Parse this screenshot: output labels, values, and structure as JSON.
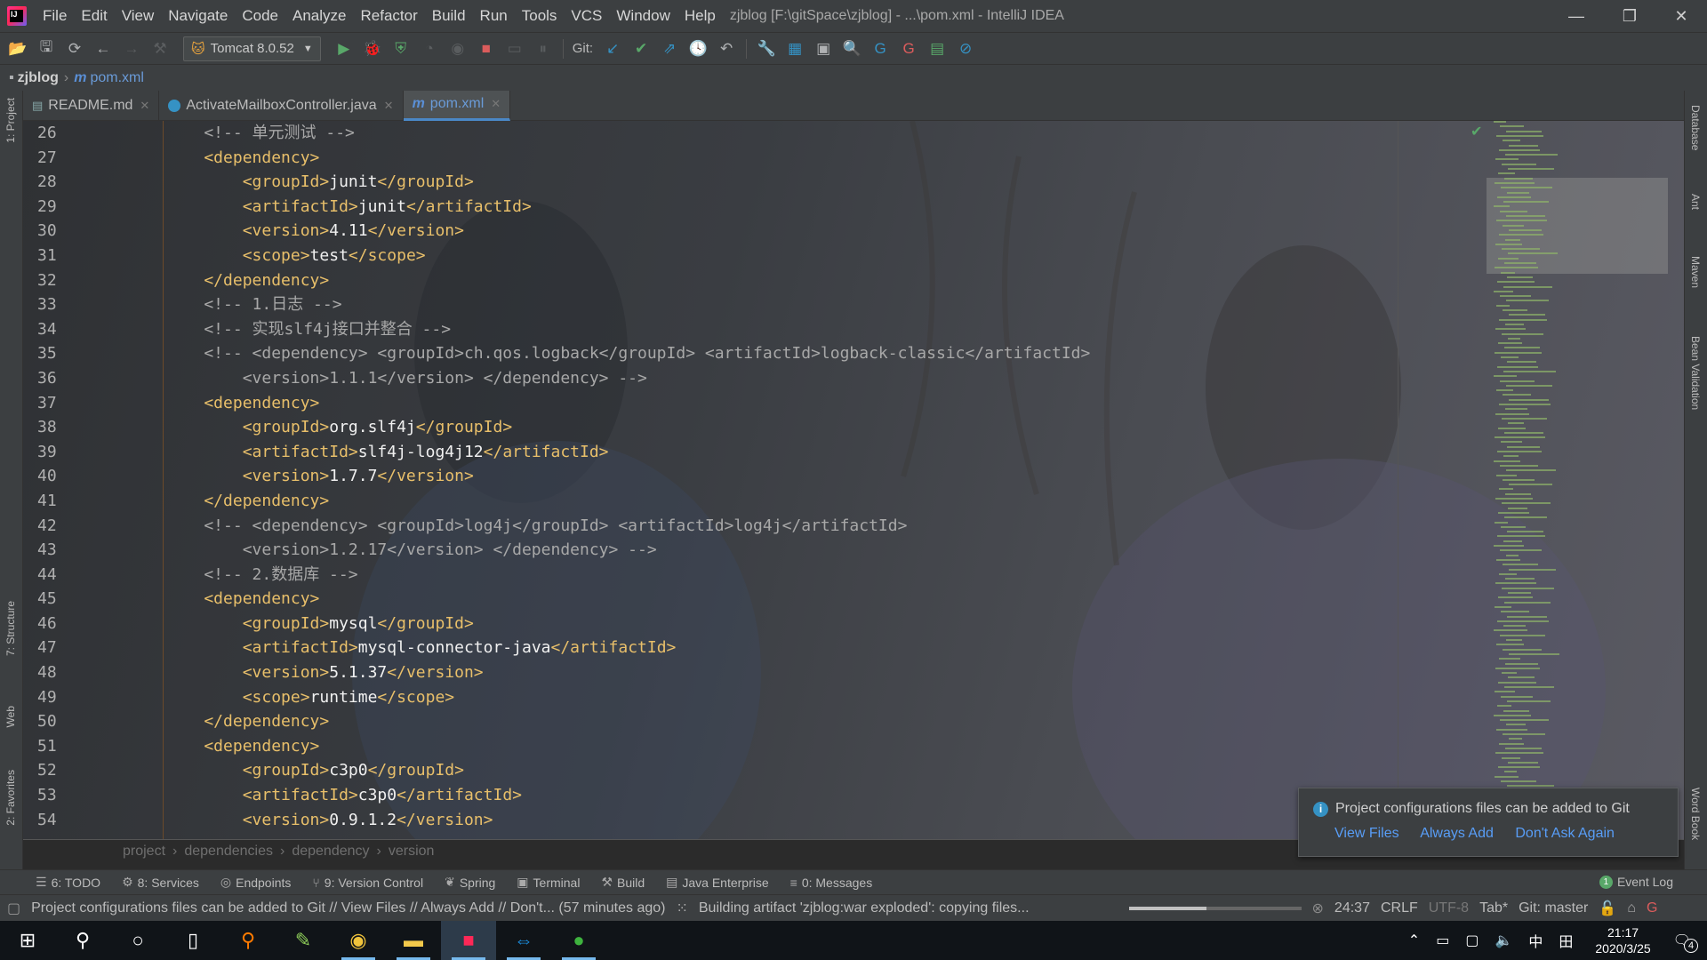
{
  "titlebar": {
    "menus": [
      "File",
      "Edit",
      "View",
      "Navigate",
      "Code",
      "Analyze",
      "Refactor",
      "Build",
      "Run",
      "Tools",
      "VCS",
      "Window",
      "Help"
    ],
    "window_title": "zjblog [F:\\gitSpace\\zjblog] - ...\\pom.xml - IntelliJ IDEA",
    "minimize": "—",
    "restore": "❐",
    "close": "✕"
  },
  "toolbar": {
    "run_config": "Tomcat 8.0.52",
    "git_label": "Git:"
  },
  "navbar": {
    "project": "zjblog",
    "file": "pom.xml"
  },
  "tabs": [
    {
      "label": "README.md",
      "icon": "markdown-icon"
    },
    {
      "label": "ActivateMailboxController.java",
      "icon": "java-class-icon"
    },
    {
      "label": "pom.xml",
      "icon": "maven-icon"
    }
  ],
  "left_stripe": [
    "1: Project",
    "7: Structure",
    "Web",
    "2: Favorites"
  ],
  "right_stripe": [
    "Database",
    "Ant",
    "Maven",
    "Bean Validation",
    "Word Book"
  ],
  "editor": {
    "line_numbers": [
      "26",
      "27",
      "28",
      "29",
      "30",
      "31",
      "32",
      "33",
      "34",
      "35",
      "36",
      "37",
      "38",
      "39",
      "40",
      "41",
      "42",
      "43",
      "44",
      "45",
      "46",
      "47",
      "48",
      "49",
      "50",
      "51",
      "52",
      "53",
      "54"
    ],
    "lines": [
      [
        {
          "t": "cm",
          "v": "    <!-- 单元测试 -->"
        }
      ],
      [
        {
          "t": "tag",
          "v": "    <dependency>"
        }
      ],
      [
        {
          "t": "tag",
          "v": "        <groupId>"
        },
        {
          "t": "tx",
          "v": "junit"
        },
        {
          "t": "tag",
          "v": "</groupId>"
        }
      ],
      [
        {
          "t": "tag",
          "v": "        <artifactId>"
        },
        {
          "t": "tx",
          "v": "junit"
        },
        {
          "t": "tag",
          "v": "</artifactId>"
        }
      ],
      [
        {
          "t": "tag",
          "v": "        <version>"
        },
        {
          "t": "tx",
          "v": "4.11"
        },
        {
          "t": "tag",
          "v": "</version>"
        }
      ],
      [
        {
          "t": "tag",
          "v": "        <scope>"
        },
        {
          "t": "tx",
          "v": "test"
        },
        {
          "t": "tag",
          "v": "</scope>"
        }
      ],
      [
        {
          "t": "tag",
          "v": "    </dependency>"
        }
      ],
      [
        {
          "t": "cm",
          "v": "    <!-- 1.日志 -->"
        }
      ],
      [
        {
          "t": "cm",
          "v": "    <!-- 实现slf4j接口并整合 -->"
        }
      ],
      [
        {
          "t": "cm",
          "v": "    <!-- <dependency> <groupId>ch.qos.logback</groupId> <artifactId>logback-classic</artifactId>"
        }
      ],
      [
        {
          "t": "cm",
          "v": "        <version>1.1.1</version> </dependency> -->"
        }
      ],
      [
        {
          "t": "tag",
          "v": "    <dependency>"
        }
      ],
      [
        {
          "t": "tag",
          "v": "        <groupId>"
        },
        {
          "t": "tx",
          "v": "org.slf4j"
        },
        {
          "t": "tag",
          "v": "</groupId>"
        }
      ],
      [
        {
          "t": "tag",
          "v": "        <artifactId>"
        },
        {
          "t": "tx",
          "v": "slf4j-log4j12"
        },
        {
          "t": "tag",
          "v": "</artifactId>"
        }
      ],
      [
        {
          "t": "tag",
          "v": "        <version>"
        },
        {
          "t": "tx",
          "v": "1.7.7"
        },
        {
          "t": "tag",
          "v": "</version>"
        }
      ],
      [
        {
          "t": "tag",
          "v": "    </dependency>"
        }
      ],
      [
        {
          "t": "cm",
          "v": "    <!-- <dependency> <groupId>log4j</groupId> <artifactId>log4j</artifactId>"
        }
      ],
      [
        {
          "t": "cm",
          "v": "        <version>1.2.17</version> </dependency> -->"
        }
      ],
      [
        {
          "t": "cm",
          "v": "    <!-- 2.数据库 -->"
        }
      ],
      [
        {
          "t": "tag",
          "v": "    <dependency>"
        }
      ],
      [
        {
          "t": "tag",
          "v": "        <groupId>"
        },
        {
          "t": "tx",
          "v": "mysql"
        },
        {
          "t": "tag",
          "v": "</groupId>"
        }
      ],
      [
        {
          "t": "tag",
          "v": "        <artifactId>"
        },
        {
          "t": "tx",
          "v": "mysql-connector-java"
        },
        {
          "t": "tag",
          "v": "</artifactId>"
        }
      ],
      [
        {
          "t": "tag",
          "v": "        <version>"
        },
        {
          "t": "tx",
          "v": "5.1.37"
        },
        {
          "t": "tag",
          "v": "</version>"
        }
      ],
      [
        {
          "t": "tag",
          "v": "        <scope>"
        },
        {
          "t": "tx",
          "v": "runtime"
        },
        {
          "t": "tag",
          "v": "</scope>"
        }
      ],
      [
        {
          "t": "tag",
          "v": "    </dependency>"
        }
      ],
      [
        {
          "t": "tag",
          "v": "    <dependency>"
        }
      ],
      [
        {
          "t": "tag",
          "v": "        <groupId>"
        },
        {
          "t": "tx",
          "v": "c3p0"
        },
        {
          "t": "tag",
          "v": "</groupId>"
        }
      ],
      [
        {
          "t": "tag",
          "v": "        <artifactId>"
        },
        {
          "t": "tx",
          "v": "c3p0"
        },
        {
          "t": "tag",
          "v": "</artifactId>"
        }
      ],
      [
        {
          "t": "tag",
          "v": "        <version>"
        },
        {
          "t": "tx",
          "v": "0.9.1.2"
        },
        {
          "t": "tag",
          "v": "</version>"
        }
      ]
    ],
    "breadcrumb": [
      "project",
      "dependencies",
      "dependency",
      "version"
    ]
  },
  "notification": {
    "message": "Project configurations files can be added to Git",
    "links": [
      "View Files",
      "Always Add",
      "Don't Ask Again"
    ]
  },
  "tool_windows": [
    {
      "label": "6: TODO",
      "icon": "todo-icon"
    },
    {
      "label": "8: Services",
      "icon": "services-icon"
    },
    {
      "label": "Endpoints",
      "icon": "endpoints-icon"
    },
    {
      "label": "9: Version Control",
      "icon": "vcs-icon"
    },
    {
      "label": "Spring",
      "icon": "spring-icon"
    },
    {
      "label": "Terminal",
      "icon": "terminal-icon"
    },
    {
      "label": "Build",
      "icon": "build-icon"
    },
    {
      "label": "Java Enterprise",
      "icon": "java-enterprise-icon"
    },
    {
      "label": "0: Messages",
      "icon": "messages-icon"
    }
  ],
  "event_log": {
    "label": "Event Log",
    "count": "1"
  },
  "statusbar": {
    "message": "Project configurations files can be added to Git // View Files // Always Add // Don't... (57 minutes ago)",
    "task": "Building artifact 'zjblog:war exploded': copying files...",
    "progress": 0.45,
    "position": "24:37",
    "line_separator": "CRLF",
    "encoding": "UTF-8",
    "indent": "Tab*",
    "branch": "Git: master"
  },
  "taskbar": {
    "time": "21:17",
    "date": "2020/3/25",
    "ime": "中",
    "notifications_count": "4"
  },
  "colors": {
    "accent": "#4a88c7",
    "tag": "#e8bf6a",
    "comment": "#a8a8a8",
    "link": "#589df6"
  }
}
